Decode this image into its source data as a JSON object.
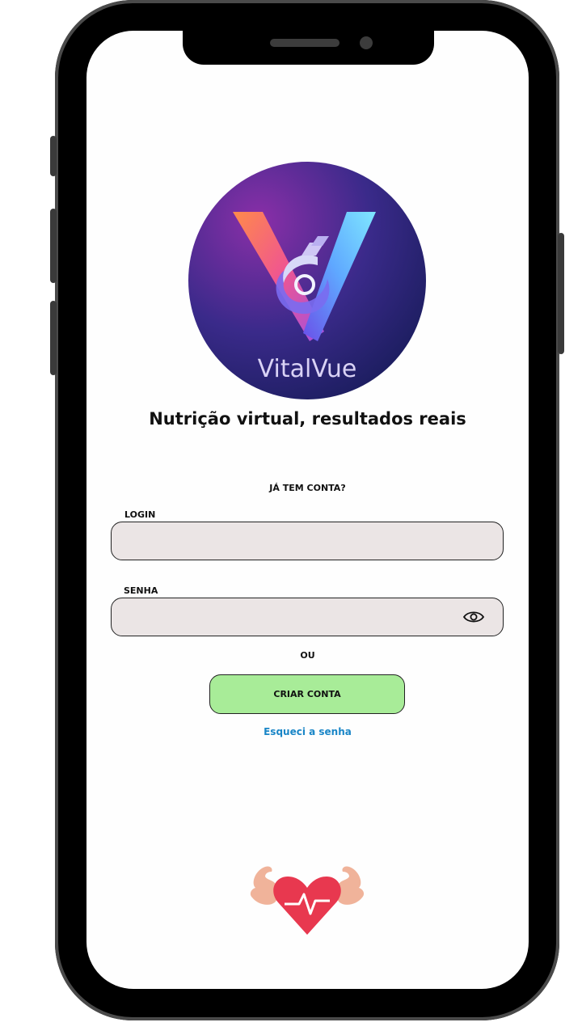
{
  "brand": {
    "name": "VitalVue",
    "tagline": "Nutrição virtual, resultados reais"
  },
  "login_section": {
    "heading": "JÁ TEM CONTA?",
    "login_label": "LOGIN",
    "login_value": "",
    "password_label": "SENHA",
    "password_value": "",
    "separator": "OU",
    "create_account": "CRIAR CONTA",
    "forgot_password": "Esqueci a senha"
  },
  "icons": {
    "logo": "vitalvue-logo",
    "password_toggle": "eye-icon",
    "footer": "heart-muscle-icon"
  },
  "colors": {
    "create_button": "#a8ec98",
    "input_background": "#ebe5e5",
    "link": "#1a86c7",
    "heart": "#e8384f"
  }
}
